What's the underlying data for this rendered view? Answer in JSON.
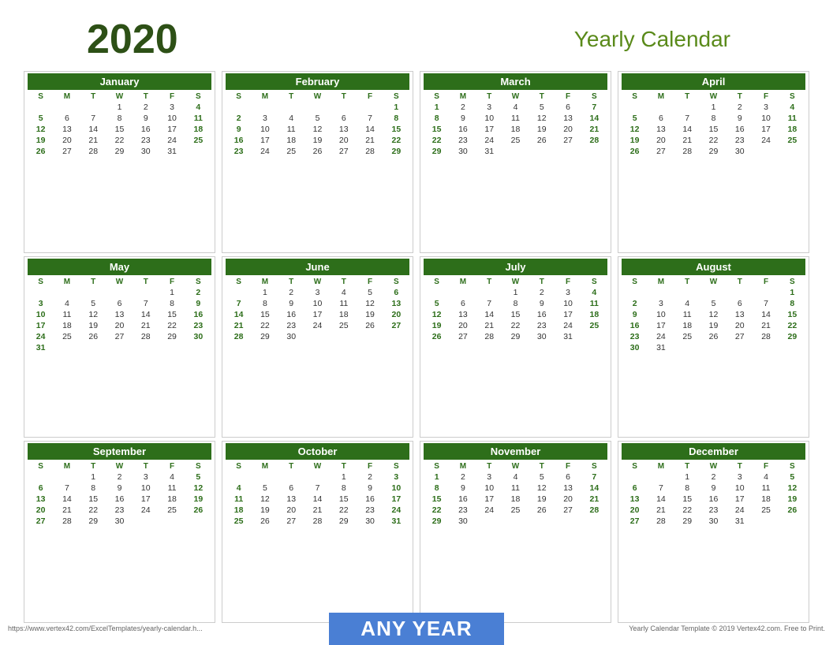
{
  "header": {
    "year": "2020",
    "title": "Yearly Calendar"
  },
  "footer": {
    "url": "https://www.vertex42.com/ExcelTemplates/yearly-calendar.h...",
    "banner": "ANY YEAR",
    "copyright": "Yearly Calendar Template © 2019 Vertex42.com. Free to Print."
  },
  "months": [
    {
      "name": "January",
      "days": [
        [
          "",
          "",
          "",
          "1",
          "2",
          "3",
          "4"
        ],
        [
          "5",
          "6",
          "7",
          "8",
          "9",
          "10",
          "11"
        ],
        [
          "12",
          "13",
          "14",
          "15",
          "16",
          "17",
          "18"
        ],
        [
          "19",
          "20",
          "21",
          "22",
          "23",
          "24",
          "25"
        ],
        [
          "26",
          "27",
          "28",
          "29",
          "30",
          "31",
          ""
        ]
      ]
    },
    {
      "name": "February",
      "days": [
        [
          "",
          "",
          "",
          "",
          "",
          "",
          "1"
        ],
        [
          "2",
          "3",
          "4",
          "5",
          "6",
          "7",
          "8"
        ],
        [
          "9",
          "10",
          "11",
          "12",
          "13",
          "14",
          "15"
        ],
        [
          "16",
          "17",
          "18",
          "19",
          "20",
          "21",
          "22"
        ],
        [
          "23",
          "24",
          "25",
          "26",
          "27",
          "28",
          "29"
        ]
      ]
    },
    {
      "name": "March",
      "days": [
        [
          "1",
          "2",
          "3",
          "4",
          "5",
          "6",
          "7"
        ],
        [
          "8",
          "9",
          "10",
          "11",
          "12",
          "13",
          "14"
        ],
        [
          "15",
          "16",
          "17",
          "18",
          "19",
          "20",
          "21"
        ],
        [
          "22",
          "23",
          "24",
          "25",
          "26",
          "27",
          "28"
        ],
        [
          "29",
          "30",
          "31",
          "",
          "",
          "",
          ""
        ]
      ]
    },
    {
      "name": "April",
      "days": [
        [
          "",
          "",
          "",
          "1",
          "2",
          "3",
          "4"
        ],
        [
          "5",
          "6",
          "7",
          "8",
          "9",
          "10",
          "11"
        ],
        [
          "12",
          "13",
          "14",
          "15",
          "16",
          "17",
          "18"
        ],
        [
          "19",
          "20",
          "21",
          "22",
          "23",
          "24",
          "25"
        ],
        [
          "26",
          "27",
          "28",
          "29",
          "30",
          "",
          ""
        ]
      ]
    },
    {
      "name": "May",
      "days": [
        [
          "",
          "",
          "",
          "",
          "",
          "1",
          "2"
        ],
        [
          "3",
          "4",
          "5",
          "6",
          "7",
          "8",
          "9"
        ],
        [
          "10",
          "11",
          "12",
          "13",
          "14",
          "15",
          "16"
        ],
        [
          "17",
          "18",
          "19",
          "20",
          "21",
          "22",
          "23"
        ],
        [
          "24",
          "25",
          "26",
          "27",
          "28",
          "29",
          "30"
        ],
        [
          "31",
          "",
          "",
          "",
          "",
          "",
          ""
        ]
      ]
    },
    {
      "name": "June",
      "days": [
        [
          "",
          "1",
          "2",
          "3",
          "4",
          "5",
          "6"
        ],
        [
          "7",
          "8",
          "9",
          "10",
          "11",
          "12",
          "13"
        ],
        [
          "14",
          "15",
          "16",
          "17",
          "18",
          "19",
          "20"
        ],
        [
          "21",
          "22",
          "23",
          "24",
          "25",
          "26",
          "27"
        ],
        [
          "28",
          "29",
          "30",
          "",
          "",
          "",
          ""
        ]
      ]
    },
    {
      "name": "July",
      "days": [
        [
          "",
          "",
          "",
          "1",
          "2",
          "3",
          "4"
        ],
        [
          "5",
          "6",
          "7",
          "8",
          "9",
          "10",
          "11"
        ],
        [
          "12",
          "13",
          "14",
          "15",
          "16",
          "17",
          "18"
        ],
        [
          "19",
          "20",
          "21",
          "22",
          "23",
          "24",
          "25"
        ],
        [
          "26",
          "27",
          "28",
          "29",
          "30",
          "31",
          ""
        ]
      ]
    },
    {
      "name": "August",
      "days": [
        [
          "",
          "",
          "",
          "",
          "",
          "",
          "1"
        ],
        [
          "2",
          "3",
          "4",
          "5",
          "6",
          "7",
          "8"
        ],
        [
          "9",
          "10",
          "11",
          "12",
          "13",
          "14",
          "15"
        ],
        [
          "16",
          "17",
          "18",
          "19",
          "20",
          "21",
          "22"
        ],
        [
          "23",
          "24",
          "25",
          "26",
          "27",
          "28",
          "29"
        ],
        [
          "30",
          "31",
          "",
          "",
          "",
          "",
          ""
        ]
      ]
    },
    {
      "name": "September",
      "days": [
        [
          "",
          "",
          "1",
          "2",
          "3",
          "4",
          "5"
        ],
        [
          "6",
          "7",
          "8",
          "9",
          "10",
          "11",
          "12"
        ],
        [
          "13",
          "14",
          "15",
          "16",
          "17",
          "18",
          "19"
        ],
        [
          "20",
          "21",
          "22",
          "23",
          "24",
          "25",
          "26"
        ],
        [
          "27",
          "28",
          "29",
          "30",
          "",
          "",
          ""
        ]
      ]
    },
    {
      "name": "October",
      "days": [
        [
          "",
          "",
          "",
          "",
          "1",
          "2",
          "3"
        ],
        [
          "4",
          "5",
          "6",
          "7",
          "8",
          "9",
          "10"
        ],
        [
          "11",
          "12",
          "13",
          "14",
          "15",
          "16",
          "17"
        ],
        [
          "18",
          "19",
          "20",
          "21",
          "22",
          "23",
          "24"
        ],
        [
          "25",
          "26",
          "27",
          "28",
          "29",
          "30",
          "31"
        ]
      ]
    },
    {
      "name": "November",
      "days": [
        [
          "1",
          "2",
          "3",
          "4",
          "5",
          "6",
          "7"
        ],
        [
          "8",
          "9",
          "10",
          "11",
          "12",
          "13",
          "14"
        ],
        [
          "15",
          "16",
          "17",
          "18",
          "19",
          "20",
          "21"
        ],
        [
          "22",
          "23",
          "24",
          "25",
          "26",
          "27",
          "28"
        ],
        [
          "29",
          "30",
          "",
          "",
          "",
          "",
          ""
        ]
      ]
    },
    {
      "name": "December",
      "days": [
        [
          "",
          "",
          "1",
          "2",
          "3",
          "4",
          "5"
        ],
        [
          "6",
          "7",
          "8",
          "9",
          "10",
          "11",
          "12"
        ],
        [
          "13",
          "14",
          "15",
          "16",
          "17",
          "18",
          "19"
        ],
        [
          "20",
          "21",
          "22",
          "23",
          "24",
          "25",
          "26"
        ],
        [
          "27",
          "28",
          "29",
          "30",
          "31",
          "",
          ""
        ]
      ]
    }
  ],
  "weekdays": [
    "S",
    "M",
    "T",
    "W",
    "T",
    "F",
    "S"
  ]
}
